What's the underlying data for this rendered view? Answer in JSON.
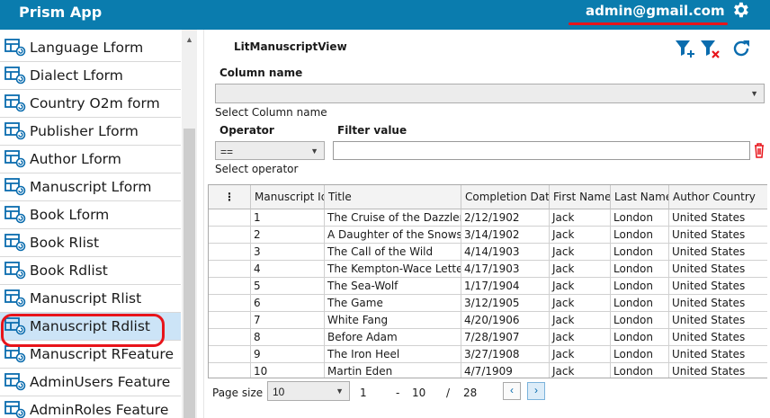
{
  "header": {
    "app_title": "Prism App",
    "user_email": "admin@gmail.com",
    "accent_color": "#0a7cae",
    "settings_icon": "gear-icon"
  },
  "sidebar": {
    "items": [
      {
        "label": "Language Lform",
        "icon": "form-icon"
      },
      {
        "label": "Dialect Lform",
        "icon": "form-icon"
      },
      {
        "label": "Country O2m form",
        "icon": "form-icon"
      },
      {
        "label": "Publisher Lform",
        "icon": "form-icon"
      },
      {
        "label": "Author Lform",
        "icon": "form-icon"
      },
      {
        "label": "Manuscript Lform",
        "icon": "form-icon"
      },
      {
        "label": "Book Lform",
        "icon": "form-icon"
      },
      {
        "label": "Book Rlist",
        "icon": "form-icon"
      },
      {
        "label": "Book Rdlist",
        "icon": "form-icon"
      },
      {
        "label": "Manuscript Rlist",
        "icon": "form-icon"
      },
      {
        "label": "Manuscript Rdlist",
        "icon": "form-icon",
        "selected": true
      },
      {
        "label": "Manuscript RFeature",
        "icon": "form-icon"
      },
      {
        "label": "AdminUsers Feature",
        "icon": "form-icon"
      },
      {
        "label": "AdminRoles Feature",
        "icon": "form-icon"
      }
    ]
  },
  "view": {
    "title": "LitManuscriptView",
    "toolbar": {
      "add_filter_icon": "filter-add-icon",
      "clear_filter_icon": "filter-remove-icon",
      "refresh_icon": "refresh-icon"
    },
    "column_name_label": "Column name",
    "column_name_value": "",
    "column_name_hint": "Select Column name",
    "operator_label": "Operator",
    "operator_value": "==",
    "operator_hint": "Select operator",
    "filter_value_label": "Filter value",
    "filter_value": "",
    "delete_icon": "trash-icon"
  },
  "grid": {
    "menu_glyph": "⋮",
    "columns": [
      "Manuscript Id",
      "Title",
      "Completion Date",
      "First Name",
      "Last Name",
      "Author Country"
    ],
    "rows": [
      [
        "1",
        "The Cruise of the Dazzler",
        "2/12/1902",
        "Jack",
        "London",
        "United States"
      ],
      [
        "2",
        "A Daughter of the Snows",
        "3/14/1902",
        "Jack",
        "London",
        "United States"
      ],
      [
        "3",
        "The Call of the Wild",
        "4/14/1903",
        "Jack",
        "London",
        "United States"
      ],
      [
        "4",
        "The Kempton-Wace Letters",
        "4/17/1903",
        "Jack",
        "London",
        "United States"
      ],
      [
        "5",
        "The Sea-Wolf",
        "1/17/1904",
        "Jack",
        "London",
        "United States"
      ],
      [
        "6",
        "The Game",
        "3/12/1905",
        "Jack",
        "London",
        "United States"
      ],
      [
        "7",
        "White Fang",
        "4/20/1906",
        "Jack",
        "London",
        "United States"
      ],
      [
        "8",
        "Before Adam",
        "7/28/1907",
        "Jack",
        "London",
        "United States"
      ],
      [
        "9",
        "The Iron Heel",
        "3/27/1908",
        "Jack",
        "London",
        "United States"
      ],
      [
        "10",
        "Martin Eden",
        "4/7/1909",
        "Jack",
        "London",
        "United States"
      ]
    ]
  },
  "paging": {
    "page_size_label": "Page size",
    "page_size_value": "10",
    "range_start": "1",
    "range_sep": "-",
    "range_end": "10",
    "total_sep": "/",
    "total": "28",
    "prev_glyph": "‹",
    "next_glyph": "›"
  }
}
